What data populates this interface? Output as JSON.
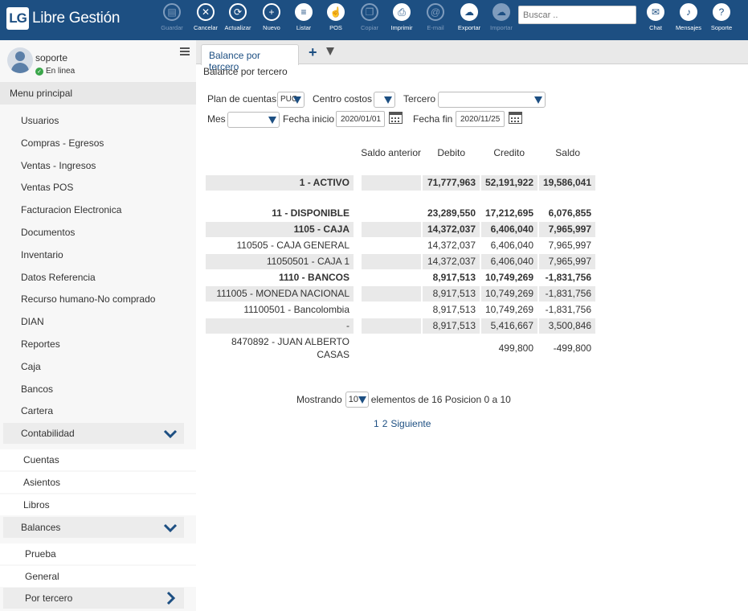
{
  "app": {
    "logo_mark": "LG",
    "title": "Libre Gestión"
  },
  "toolbar": {
    "buttons": [
      {
        "label": "Guardar",
        "icon": "save-icon",
        "glyph": "▤",
        "enabled": false
      },
      {
        "label": "Cancelar",
        "icon": "cancel-icon",
        "glyph": "✕",
        "enabled": true
      },
      {
        "label": "Actualizar",
        "icon": "refresh-icon",
        "glyph": "⟳",
        "enabled": true
      },
      {
        "label": "Nuevo",
        "icon": "plus-icon",
        "glyph": "+",
        "enabled": true
      },
      {
        "label": "Listar",
        "icon": "list-icon",
        "glyph": "≡",
        "enabled": true
      },
      {
        "label": "POS",
        "icon": "hand-pointer-icon",
        "glyph": "☝",
        "enabled": true
      },
      {
        "label": "Copiar",
        "icon": "copy-icon",
        "glyph": "❐",
        "enabled": false
      },
      {
        "label": "Imprimir",
        "icon": "printer-icon",
        "glyph": "⎙",
        "enabled": true
      },
      {
        "label": "E-mail",
        "icon": "email-icon",
        "glyph": "@",
        "enabled": false
      },
      {
        "label": "Exportar",
        "icon": "cloud-upload-icon",
        "glyph": "☁",
        "enabled": true
      },
      {
        "label": "Importar",
        "icon": "cloud-download-icon",
        "glyph": "☁",
        "enabled": false
      }
    ],
    "search_placeholder": "Buscar ..",
    "right_buttons": [
      {
        "label": "Chat",
        "icon": "chat-icon",
        "glyph": "✉"
      },
      {
        "label": "Mensajes",
        "icon": "bell-icon",
        "glyph": "♪"
      },
      {
        "label": "Soporte",
        "icon": "help-icon",
        "glyph": "?"
      }
    ]
  },
  "user": {
    "name": "soporte",
    "status": "En linea"
  },
  "sidebar": {
    "header": "Menu principal",
    "items": [
      "Usuarios",
      "Compras - Egresos",
      "Ventas - Ingresos",
      "Ventas POS",
      "Facturacion Electronica",
      "Documentos",
      "Inventario",
      "Datos Referencia",
      "Recurso humano-No comprado",
      "DIAN",
      "Reportes",
      "Caja",
      "Bancos",
      "Cartera"
    ],
    "contabilidad": "Contabilidad",
    "contabilidad_sub": [
      "Cuentas",
      "Asientos",
      "Libros"
    ],
    "balances": "Balances",
    "balances_sub": [
      "Prueba",
      "General",
      "Por tercero"
    ]
  },
  "tabs": {
    "active": "Balance por tercero"
  },
  "page": {
    "title": "Balance por tercero"
  },
  "filters": {
    "plan_label": "Plan de cuentas",
    "plan_value": "PUC",
    "centro_label": "Centro costos",
    "centro_value": "",
    "tercero_label": "Tercero",
    "tercero_value": "",
    "mes_label": "Mes",
    "mes_value": "",
    "fecha_inicio_label": "Fecha inicio",
    "fecha_inicio": "2020/01/01",
    "fecha_fin_label": "Fecha fin",
    "fecha_fin": "2020/11/25"
  },
  "table": {
    "headers": [
      "Saldo anterior",
      "Debito",
      "Credito",
      "Saldo"
    ],
    "rows": [
      {
        "cuenta": "1 - ACTIVO",
        "saldo_anterior": "",
        "debito": "71,777,963",
        "credito": "52,191,922",
        "saldo": "19,586,041",
        "bold": true,
        "shade": true
      },
      {
        "cuenta": "11 - DISPONIBLE",
        "saldo_anterior": "",
        "debito": "23,289,550",
        "credito": "17,212,695",
        "saldo": "6,076,855",
        "bold": true,
        "shade": false
      },
      {
        "cuenta": "1105 - CAJA",
        "saldo_anterior": "",
        "debito": "14,372,037",
        "credito": "6,406,040",
        "saldo": "7,965,997",
        "bold": true,
        "shade": true
      },
      {
        "cuenta": "110505 - CAJA GENERAL",
        "saldo_anterior": "",
        "debito": "14,372,037",
        "credito": "6,406,040",
        "saldo": "7,965,997",
        "bold": false,
        "shade": false
      },
      {
        "cuenta": "11050501 - CAJA 1",
        "saldo_anterior": "",
        "debito": "14,372,037",
        "credito": "6,406,040",
        "saldo": "7,965,997",
        "bold": false,
        "shade": true
      },
      {
        "cuenta": "1110 - BANCOS",
        "saldo_anterior": "",
        "debito": "8,917,513",
        "credito": "10,749,269",
        "saldo": "-1,831,756",
        "bold": true,
        "shade": false
      },
      {
        "cuenta": "111005 - MONEDA NACIONAL",
        "saldo_anterior": "",
        "debito": "8,917,513",
        "credito": "10,749,269",
        "saldo": "-1,831,756",
        "bold": false,
        "shade": true
      },
      {
        "cuenta": "11100501 - Bancolombia",
        "saldo_anterior": "",
        "debito": "8,917,513",
        "credito": "10,749,269",
        "saldo": "-1,831,756",
        "bold": false,
        "shade": false
      },
      {
        "cuenta": "-",
        "saldo_anterior": "",
        "debito": "8,917,513",
        "credito": "5,416,667",
        "saldo": "3,500,846",
        "bold": false,
        "shade": true
      },
      {
        "cuenta": "8470892 - JUAN ALBERTO CASAS",
        "saldo_anterior": "",
        "debito": "",
        "credito": "499,800",
        "saldo": "-499,800",
        "bold": false,
        "shade": false
      }
    ]
  },
  "pager": {
    "prefix": "Mostrando",
    "page_size": "10",
    "suffix": "elementos de 16 Posicion 0 a 10",
    "pages": [
      "1",
      "2",
      "Siguiente"
    ]
  }
}
